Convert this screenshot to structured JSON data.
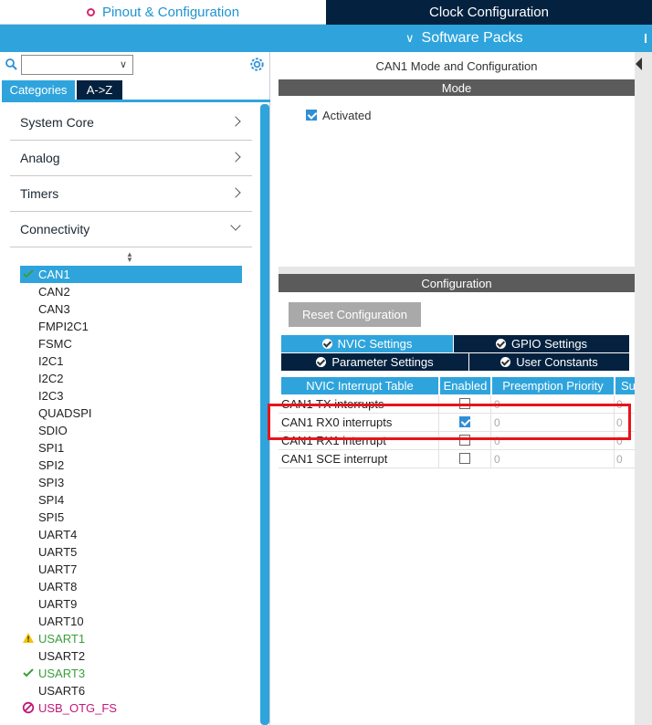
{
  "top_tabs": {
    "pinout": "Pinout & Configuration",
    "clock": "Clock Configuration"
  },
  "software_packs": "Software Packs",
  "left": {
    "search": {
      "value": "",
      "placeholder": ""
    },
    "tabs": {
      "categories": "Categories",
      "az": "A->Z"
    },
    "categories": [
      {
        "label": "System Core"
      },
      {
        "label": "Analog"
      },
      {
        "label": "Timers"
      },
      {
        "label": "Connectivity"
      }
    ],
    "connectivity_items": [
      {
        "label": "CAN1",
        "status": "selected-ok"
      },
      {
        "label": "CAN2",
        "status": "none"
      },
      {
        "label": "CAN3",
        "status": "none"
      },
      {
        "label": "FMPI2C1",
        "status": "none"
      },
      {
        "label": "FSMC",
        "status": "none"
      },
      {
        "label": "I2C1",
        "status": "none"
      },
      {
        "label": "I2C2",
        "status": "none"
      },
      {
        "label": "I2C3",
        "status": "none"
      },
      {
        "label": "QUADSPI",
        "status": "none"
      },
      {
        "label": "SDIO",
        "status": "none"
      },
      {
        "label": "SPI1",
        "status": "none"
      },
      {
        "label": "SPI2",
        "status": "none"
      },
      {
        "label": "SPI3",
        "status": "none"
      },
      {
        "label": "SPI4",
        "status": "none"
      },
      {
        "label": "SPI5",
        "status": "none"
      },
      {
        "label": "UART4",
        "status": "none"
      },
      {
        "label": "UART5",
        "status": "none"
      },
      {
        "label": "UART7",
        "status": "none"
      },
      {
        "label": "UART8",
        "status": "none"
      },
      {
        "label": "UART9",
        "status": "none"
      },
      {
        "label": "UART10",
        "status": "none"
      },
      {
        "label": "USART1",
        "status": "warning"
      },
      {
        "label": "USART2",
        "status": "none"
      },
      {
        "label": "USART3",
        "status": "ok"
      },
      {
        "label": "USART6",
        "status": "none"
      },
      {
        "label": "USB_OTG_FS",
        "status": "error"
      }
    ]
  },
  "right": {
    "title": "CAN1 Mode and Configuration",
    "mode_header": "Mode",
    "activated_label": "Activated",
    "activated": true,
    "config_header": "Configuration",
    "reset_button": "Reset Configuration",
    "settings_tabs": {
      "nvic": "NVIC Settings",
      "gpio": "GPIO Settings",
      "param": "Parameter Settings",
      "user": "User Constants"
    },
    "table": {
      "headers": [
        "NVIC Interrupt Table",
        "Enabled",
        "Preemption Priority",
        "Su"
      ],
      "rows": [
        {
          "name": "CAN1 TX interrupts",
          "enabled": false,
          "preemption": "0",
          "sub": "0"
        },
        {
          "name": "CAN1 RX0 interrupts",
          "enabled": true,
          "preemption": "0",
          "sub": "0"
        },
        {
          "name": "CAN1 RX1 interrupt",
          "enabled": false,
          "preemption": "0",
          "sub": "0"
        },
        {
          "name": "CAN1 SCE interrupt",
          "enabled": false,
          "preemption": "0",
          "sub": "0"
        }
      ]
    }
  },
  "colors": {
    "accent": "#2fa4dc",
    "dark": "#04223f",
    "ok": "#3a9e3a",
    "warning": "#f5c400",
    "error": "#c2187a",
    "highlight": "#e8141a"
  }
}
